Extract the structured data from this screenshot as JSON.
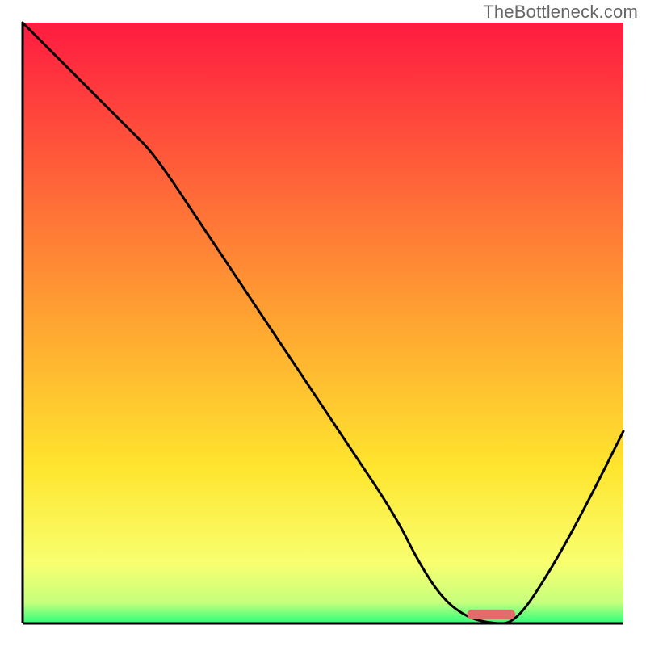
{
  "watermark": "TheBottleneck.com",
  "chart_data": {
    "type": "line",
    "title": "",
    "xlabel": "",
    "ylabel": "",
    "xlim": [
      0,
      100
    ],
    "ylim": [
      0,
      100
    ],
    "grid": false,
    "legend": false,
    "series": [
      {
        "name": "bottleneck-curve",
        "x": [
          0,
          6,
          12,
          18,
          22,
          30,
          38,
          46,
          54,
          62,
          66,
          70,
          74,
          78,
          82,
          88,
          94,
          100
        ],
        "y": [
          100,
          94,
          88,
          82,
          78,
          66,
          54,
          42,
          30,
          18,
          10,
          4,
          1,
          0,
          0,
          9,
          20,
          32
        ]
      }
    ],
    "marker": {
      "name": "optimal-range-bar",
      "x_start": 74,
      "x_end": 82,
      "y": 1.5,
      "color": "#e46a6c"
    },
    "background_gradient": {
      "stops": [
        {
          "pos": 0.0,
          "color": "#ff1b41"
        },
        {
          "pos": 0.5,
          "color": "#ffa531"
        },
        {
          "pos": 0.74,
          "color": "#ffe52e"
        },
        {
          "pos": 0.9,
          "color": "#f8ff6f"
        },
        {
          "pos": 0.965,
          "color": "#c7ff7d"
        },
        {
          "pos": 1.0,
          "color": "#2bff7a"
        }
      ]
    }
  }
}
